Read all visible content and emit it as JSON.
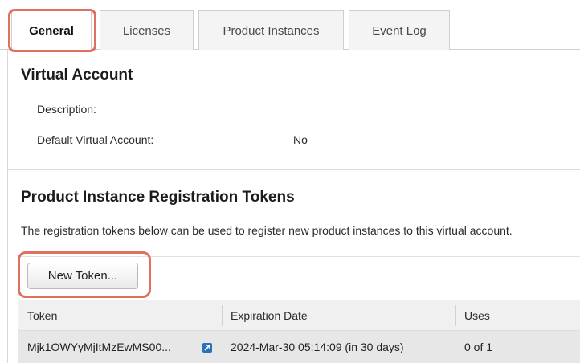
{
  "tabs": [
    {
      "label": "General",
      "active": true
    },
    {
      "label": "Licenses",
      "active": false
    },
    {
      "label": "Product Instances",
      "active": false
    },
    {
      "label": "Event Log",
      "active": false
    }
  ],
  "virtual_account": {
    "title": "Virtual Account",
    "description_label": "Description:",
    "description_value": "",
    "default_label": "Default Virtual Account:",
    "default_value": "No"
  },
  "tokens": {
    "title": "Product Instance Registration Tokens",
    "description": "The registration tokens below can be used to register new product instances to this virtual account.",
    "new_token_label": "New Token...",
    "columns": [
      "Token",
      "Expiration Date",
      "Uses"
    ],
    "rows": [
      {
        "token": "Mjk1OWYyMjItMzEwMS00...",
        "expiration": "2024-Mar-30 05:14:09 (in 30 days)",
        "uses": "0 of 1",
        "copy_icon": "external-link-icon"
      }
    ]
  },
  "colors": {
    "highlight": "#e07060",
    "link_icon": "#2a6fb8"
  }
}
